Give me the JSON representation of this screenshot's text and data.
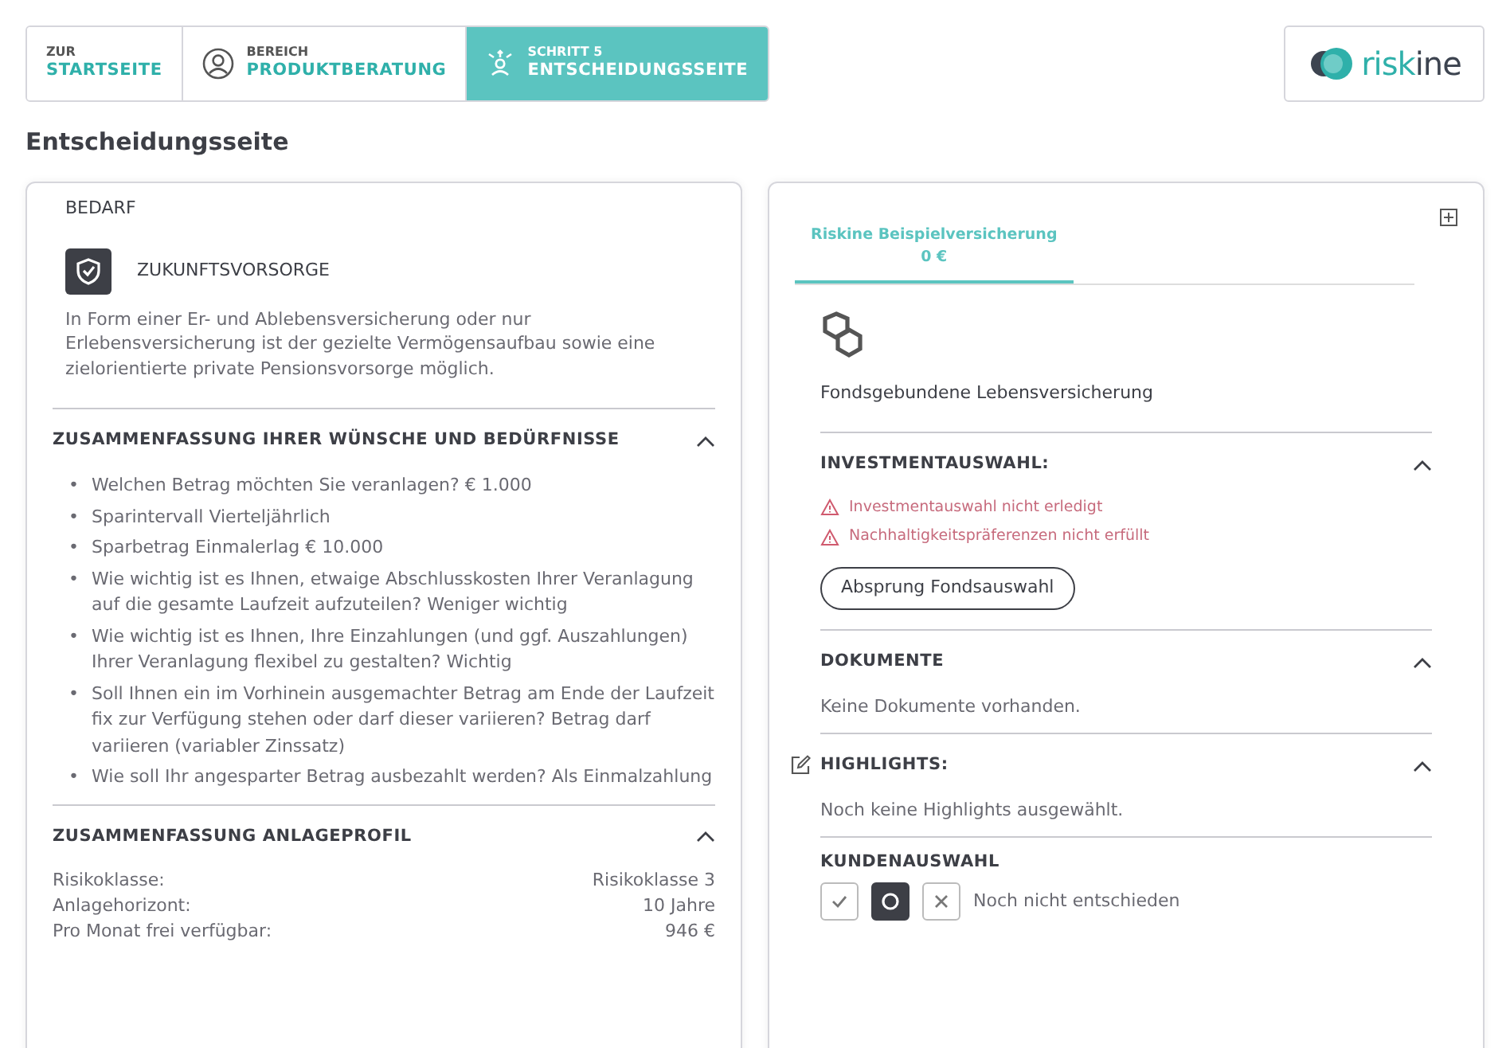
{
  "breadcrumb": [
    {
      "kind": "home",
      "caption": "ZUR",
      "label": "STARTSEITE",
      "selected": false
    },
    {
      "kind": "area",
      "caption": "BEREICH",
      "label": "PRODUKTBERATUNG",
      "selected": false
    },
    {
      "kind": "step",
      "caption": "SCHRITT 5",
      "label": "ENTSCHEIDUNGSSEITE",
      "selected": true
    }
  ],
  "logo": {
    "parts": [
      "risk",
      "ine"
    ]
  },
  "page_title": "Entscheidungsseite",
  "left": {
    "need": {
      "heading": "BEDARF",
      "title": "ZUKUNFTSVORSORGE",
      "description": "In Form einer Er- und Ablebensversicherung oder nur Erlebensversicherung ist der gezielte Vermögensaufbau sowie eine zielorientierte private Pensionsvorsorge möglich."
    },
    "wishes": {
      "title": "ZUSAMMENFASSUNG IHRER WÜNSCHE UND BEDÜRFNISSE",
      "expanded": true,
      "bullet": "•",
      "items": [
        "Welchen Betrag möchten Sie veranlagen? € 1.000",
        "Sparintervall Vierteljährlich",
        "Sparbetrag Einmalerlag € 10.000",
        "Wie wichtig ist es Ihnen, etwaige Abschlusskosten Ihrer Veranlagung auf die gesamte Laufzeit aufzuteilen? Weniger wichtig",
        "Wie wichtig ist es Ihnen, Ihre Einzahlungen (und ggf. Auszahlungen) Ihrer Veranlagung flexibel zu gestalten? Wichtig",
        "Soll Ihnen ein im Vorhinein ausgemachter Betrag am Ende der Laufzeit fix zur Verfügung stehen oder darf dieser variieren? Betrag darf variieren (variabler Zinssatz)",
        "Wie soll Ihr angesparter Betrag ausbezahlt werden? Als Einmalzahlung"
      ]
    },
    "profile": {
      "title": "ZUSAMMENFASSUNG ANLAGEPROFIL",
      "expanded": true,
      "rows": [
        {
          "label": "Risikoklasse:",
          "value": "Risikoklasse 3"
        },
        {
          "label": "Anlagehorizont:",
          "value": "10 Jahre"
        },
        {
          "label": "Pro Monat frei verfügbar:",
          "value": "946 €"
        }
      ]
    }
  },
  "right": {
    "tabs": [
      {
        "label": "Riskine Beispielversicherung",
        "amount": "0 €",
        "selected": true
      }
    ],
    "product": "Fondsgebundene Lebensversicherung",
    "investment": {
      "title": "INVESTMENTAUSWAHL:",
      "expanded": true,
      "warnings": [
        "Investmentauswahl nicht erledigt",
        "Nachhaltigkeitspräferenzen nicht erfüllt"
      ],
      "button": "Absprung Fondsauswahl"
    },
    "documents": {
      "title": "DOKUMENTE",
      "expanded": true,
      "text": "Keine Dokumente vorhanden."
    },
    "highlights": {
      "title": "HIGHLIGHTS:",
      "expanded": true,
      "text": "Noch keine Highlights ausgewählt."
    },
    "customer_choice": {
      "title": "KUNDENAUSWAHL",
      "options": [
        {
          "kind": "accept",
          "selected": false
        },
        {
          "kind": "undecided",
          "selected": true
        },
        {
          "kind": "reject",
          "selected": false
        }
      ],
      "status": "Noch nicht entschieden"
    }
  }
}
